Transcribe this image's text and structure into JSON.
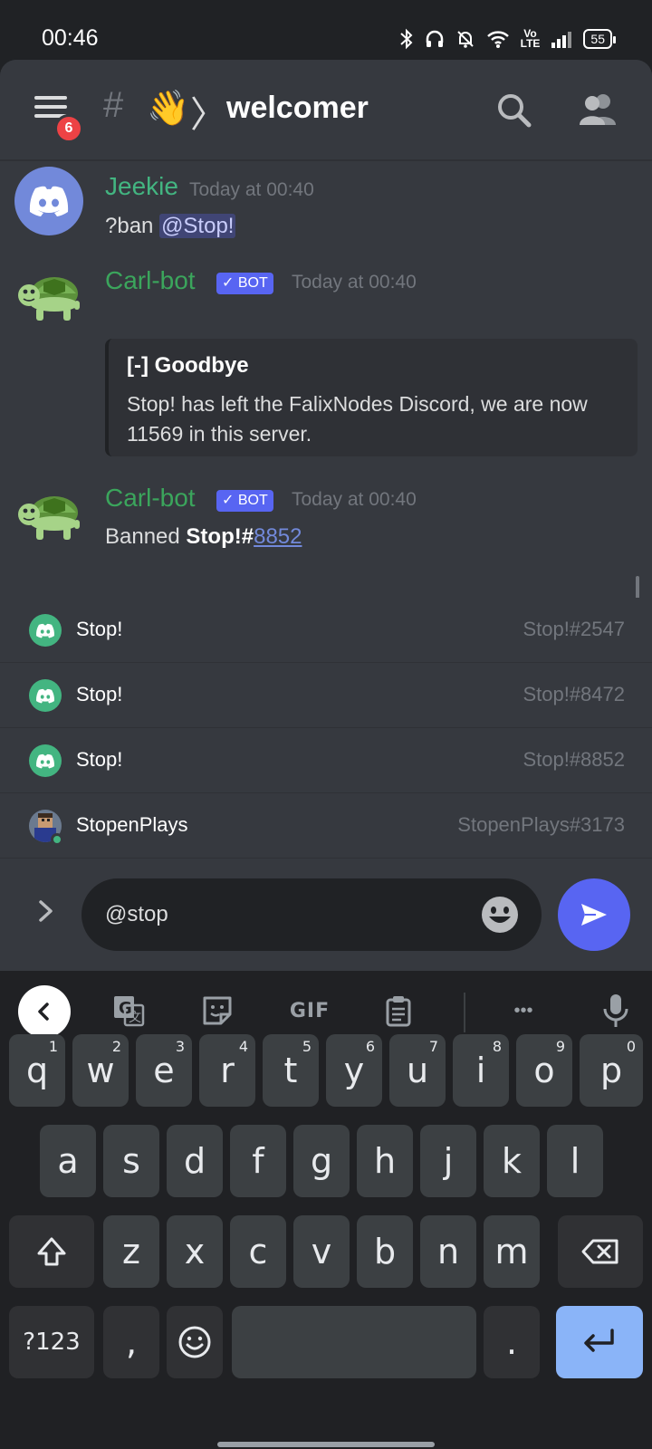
{
  "status_bar": {
    "time": "00:46",
    "volte": "Vo\nLTE",
    "battery": "55"
  },
  "header": {
    "unread_badge": "6",
    "hash": "#",
    "channel_emoji": "👋",
    "separator": "〉",
    "channel_name": "welcomer"
  },
  "messages": [
    {
      "author": "Jeekie",
      "timestamp": "Today at 00:40",
      "text_prefix": "?ban ",
      "mention": "@Stop!"
    },
    {
      "author": "Carl-bot",
      "bot_tag": "✓ BOT",
      "timestamp": "Today at 00:40",
      "embed_title": "[-] Goodbye",
      "embed_description": "Stop! has left the FalixNodes Discord, we are now 11569 in this server."
    },
    {
      "author": "Carl-bot",
      "bot_tag": "✓ BOT",
      "timestamp": "Today at 00:40",
      "text_prefix": "Banned ",
      "text_bold": "Stop!#",
      "text_link": "8852"
    }
  ],
  "suggestions": [
    {
      "name": "Stop!",
      "tag": "Stop!#2547"
    },
    {
      "name": "Stop!",
      "tag": "Stop!#8472"
    },
    {
      "name": "Stop!",
      "tag": "Stop!#8852"
    },
    {
      "name": "StopenPlays",
      "tag": "StopenPlays#3173"
    }
  ],
  "composer": {
    "value": "@stop"
  },
  "keyboard": {
    "toolbar_gif": "GIF",
    "toolbar_more": "•••",
    "row1": [
      {
        "key": "q",
        "hint": "1"
      },
      {
        "key": "w",
        "hint": "2"
      },
      {
        "key": "e",
        "hint": "3"
      },
      {
        "key": "r",
        "hint": "4"
      },
      {
        "key": "t",
        "hint": "5"
      },
      {
        "key": "y",
        "hint": "6"
      },
      {
        "key": "u",
        "hint": "7"
      },
      {
        "key": "i",
        "hint": "8"
      },
      {
        "key": "o",
        "hint": "9"
      },
      {
        "key": "p",
        "hint": "0"
      }
    ],
    "row2": [
      "a",
      "s",
      "d",
      "f",
      "g",
      "h",
      "j",
      "k",
      "l"
    ],
    "row3": [
      "z",
      "x",
      "c",
      "v",
      "b",
      "n",
      "m"
    ],
    "symbols": "?123",
    "comma": ",",
    "period": "."
  },
  "colors": {
    "background": "#36393f",
    "username_green": "#43b581",
    "blurple": "#5865f2",
    "enter_key": "#8ab4f8"
  }
}
